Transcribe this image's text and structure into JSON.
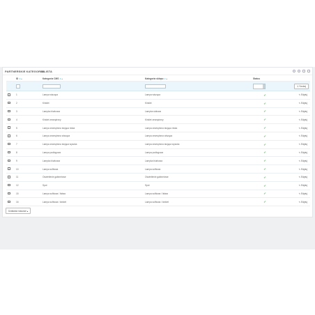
{
  "panel": {
    "title": "PARTNERSKIE KATEGORIE LISTA",
    "count": "14"
  },
  "columns": {
    "id": "ID",
    "category_cms": "Kategoria CMS",
    "category_shop": "Kategoria sklepu",
    "status": "Status"
  },
  "filters": {
    "search_label": "Szukaj"
  },
  "rows": [
    {
      "id": "1",
      "cms": "Lampa wisząca",
      "shop": "Lampa wisząca",
      "edit": "Edytuj"
    },
    {
      "id": "2",
      "cms": "Kinkiet",
      "shop": "Kinkiet",
      "edit": "Edytuj"
    },
    {
      "id": "3",
      "cms": "Lampka biurkowa",
      "shop": "Lampka stołowa",
      "edit": "Edytuj"
    },
    {
      "id": "4",
      "cms": "Kinkiet zewnętrzny",
      "shop": "Kinkiet zewnętrzny",
      "edit": "Edytuj"
    },
    {
      "id": "5",
      "cms": "Lampa zewnętrzna stojąca niska",
      "shop": "Lampa zewnętrzna stojąca niska",
      "edit": "Edytuj"
    },
    {
      "id": "6",
      "cms": "Lampa zewnętrzna wisząca",
      "shop": "Lampa zewnętrzna wisząca",
      "edit": "Edytuj"
    },
    {
      "id": "7",
      "cms": "Lampa zewnętrzna stojąca wysoka",
      "shop": "Lampa zewnętrzna stojąca wysoka",
      "edit": "Edytuj"
    },
    {
      "id": "8",
      "cms": "Lampa podłogowa",
      "shop": "Lampa podłogowa",
      "edit": "Edytuj"
    },
    {
      "id": "9",
      "cms": "Lampka biurkowa",
      "shop": "Lampka biurkowa",
      "edit": "Edytuj"
    },
    {
      "id": "10",
      "cms": "Lampa sufitowa",
      "shop": "Lampa sufitowa",
      "edit": "Edytuj"
    },
    {
      "id": "11",
      "cms": "Oświetlenie gabinetowe",
      "shop": "Oświetlenie gabinetowe",
      "edit": "Edytuj"
    },
    {
      "id": "12",
      "cms": "Spot",
      "shop": "Spot",
      "edit": "Edytuj"
    },
    {
      "id": "15",
      "cms": "Lampa sufitowa / listwa",
      "shop": "Lampa sufitowa / listwa",
      "edit": "Edytuj"
    },
    {
      "id": "16",
      "cms": "Lampa sufitowa / kinkiet",
      "shop": "Lampa sufitowa / kinkiet",
      "edit": "Edytuj"
    }
  ],
  "bulk": {
    "label": "Działania masowe ▴"
  },
  "colors": {
    "accent": "#2eacce",
    "status_ok": "#72c279",
    "filter_row": "#eaf6fb"
  }
}
